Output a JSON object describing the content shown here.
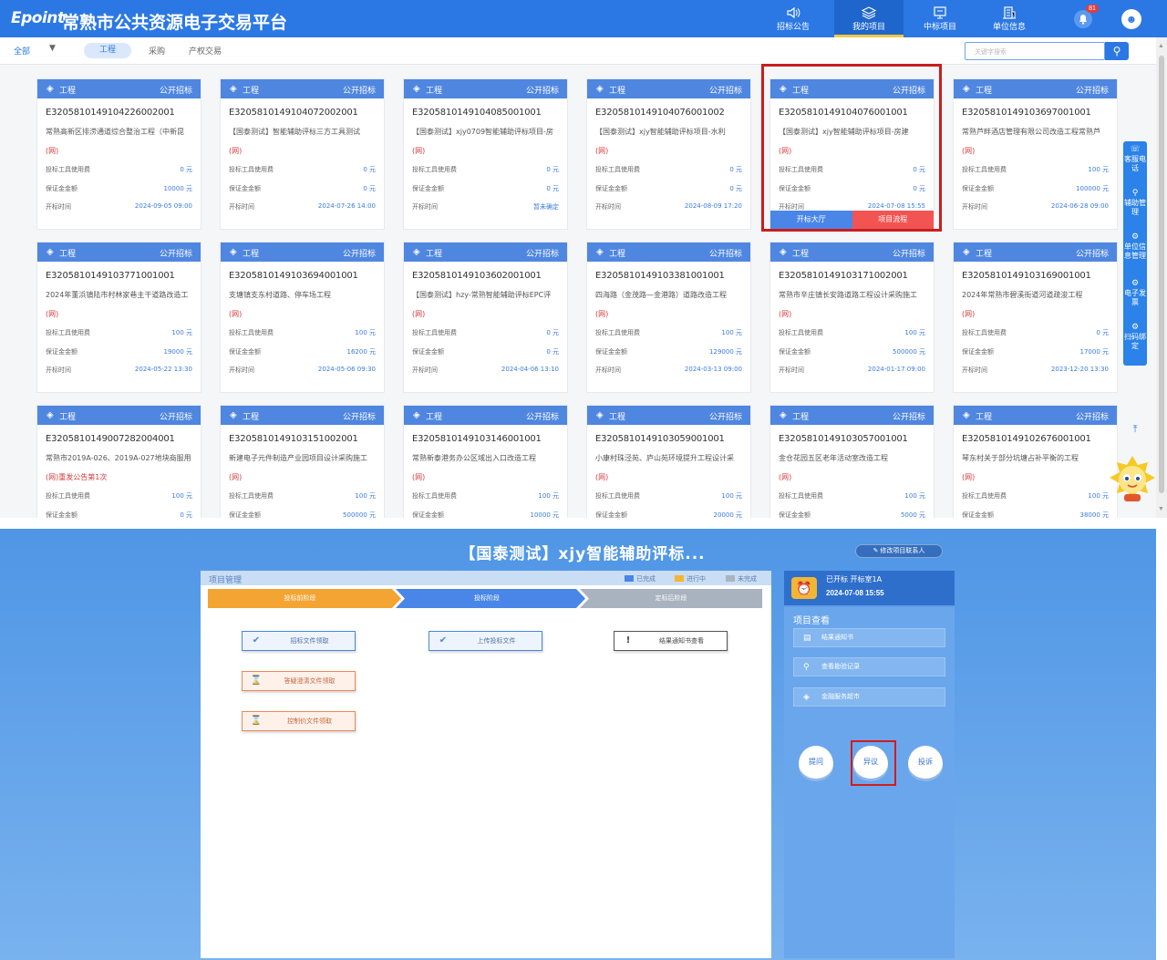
{
  "header": {
    "logo": "Epoint",
    "title": "常熟市公共资源电子交易平台",
    "nav": [
      {
        "label": "招标公告",
        "icon": "speaker-icon",
        "active": false
      },
      {
        "label": "我的项目",
        "icon": "layers-icon",
        "active": true
      },
      {
        "label": "中标项目",
        "icon": "monitor-icon",
        "active": false
      },
      {
        "label": "单位信息",
        "icon": "building-icon",
        "active": false
      }
    ],
    "notification_count": "81"
  },
  "filter": {
    "scope": "全部",
    "tabs": [
      "工程",
      "采购",
      "产权交易"
    ],
    "search_placeholder": "关键字搜索"
  },
  "card_labels": {
    "category": "工程",
    "type": "公开招标",
    "tool_fee": "投标工具使用费",
    "deposit": "保证金金额",
    "open_time": "开标时间",
    "btn_hall": "开标大厅",
    "btn_flow": "项目流程"
  },
  "cards": [
    {
      "code": "E3205810149104226002001",
      "name": "常熟高新区排涝通道综合整治工程（中新昆",
      "net": "(网)",
      "fee": "0 元",
      "deposit": "10000 元",
      "time": "2024-09-05 09:00"
    },
    {
      "code": "E3205810149104072002001",
      "name": "【国泰测试】智能辅助评标三方工具测试",
      "net": "(网)",
      "fee": "0 元",
      "deposit": "0 元",
      "time": "2024-07-26 14:00"
    },
    {
      "code": "E3205810149104085001001",
      "name": "【国泰测试】xjy0709智能辅助评标项目-房",
      "net": "(网)",
      "fee": "0 元",
      "deposit": "0 元",
      "time": "暂未确定"
    },
    {
      "code": "E3205810149104076001002",
      "name": "【国泰测试】xjy智能辅助评标项目-水利",
      "net": "(网)",
      "fee": "0 元",
      "deposit": "0 元",
      "time": "2024-08-09 17:20"
    },
    {
      "code": "E3205810149104076001001",
      "name": "【国泰测试】xjy智能辅助评标项目-房建",
      "net": "(网)",
      "fee": "0 元",
      "deposit": "0 元",
      "time": "2024-07-08 15:55"
    },
    {
      "code": "E3205810149103697001001",
      "name": "常熟芦畔酒店管理有限公司改造工程常熟芦",
      "net": "(网)",
      "fee": "100 元",
      "deposit": "100000 元",
      "time": "2024-06-28 09:00"
    },
    {
      "code": "E3205810149103771001001",
      "name": "2024年董浜镇陆市村林家巷主干道路改造工",
      "net": "(网)",
      "fee": "100 元",
      "deposit": "19000 元",
      "time": "2024-05-22 13:30"
    },
    {
      "code": "E3205810149103694001001",
      "name": "支塘镇支东村道路、停车场工程",
      "net": "(网)",
      "fee": "100 元",
      "deposit": "16200 元",
      "time": "2024-05-06 09:30"
    },
    {
      "code": "E3205810149103602001001",
      "name": "【国泰测试】hzy-常熟智能辅助评标EPC评",
      "net": "(网)",
      "fee": "0 元",
      "deposit": "0 元",
      "time": "2024-04-06 13:10"
    },
    {
      "code": "E3205810149103381001001",
      "name": "四海路（金茂路—金港路）道路改造工程",
      "net": "(网)",
      "fee": "100 元",
      "deposit": "129000 元",
      "time": "2024-03-13 09:00"
    },
    {
      "code": "E3205810149103171002001",
      "name": "常熟市辛庄镇长安路道路工程设计采购施工",
      "net": "(网)",
      "fee": "100 元",
      "deposit": "500000 元",
      "time": "2024-01-17 09:00"
    },
    {
      "code": "E3205810149103169001001",
      "name": "2024年常熟市碧溪街道河道疏浚工程",
      "net": "(网)",
      "fee": "0 元",
      "deposit": "17000 元",
      "time": "2023-12-20 13:30"
    },
    {
      "code": "E3205810149007282004001",
      "name": "常熟市2019A-026、2019A-027地块商服用",
      "net": "(网)重发公告第1次",
      "fee": "100 元",
      "deposit": "0 元",
      "time": ""
    },
    {
      "code": "E3205810149103151002001",
      "name": "新建电子元件制造产业园项目设计采购施工",
      "net": "(网)",
      "fee": "100 元",
      "deposit": "500000 元",
      "time": ""
    },
    {
      "code": "E3205810149103146001001",
      "name": "常熟新泰港务办公区域出入口改造工程",
      "net": "(网)",
      "fee": "100 元",
      "deposit": "10000 元",
      "time": ""
    },
    {
      "code": "E3205810149103059001001",
      "name": "小康村珠泾苑、庐山苑环境提升工程设计采",
      "net": "(网)",
      "fee": "100 元",
      "deposit": "20000 元",
      "time": ""
    },
    {
      "code": "E3205810149103057001001",
      "name": "金仓花园五区老年活动室改造工程",
      "net": "(网)",
      "fee": "100 元",
      "deposit": "5000 元",
      "time": ""
    },
    {
      "code": "E3205810149102676001001",
      "name": "琴东村关于部分坑塘占补平衡的工程",
      "net": "(网)",
      "fee": "100 元",
      "deposit": "38000 元",
      "time": ""
    }
  ],
  "sidebar": [
    {
      "label": "客服电话",
      "icon": "headset-icon"
    },
    {
      "label": "辅助管理",
      "icon": "search-icon"
    },
    {
      "label": "单位信息管理",
      "icon": "gear-icon"
    },
    {
      "label": "电子发票",
      "icon": "gear-icon"
    },
    {
      "label": "扫码绑定",
      "icon": "gear-icon"
    }
  ],
  "project": {
    "title": "【国泰测试】xjy智能辅助评标...",
    "edit_contact": "修改项目联系人",
    "panel_title": "项目管理",
    "legend": [
      {
        "label": "已完成",
        "color": "#4a86e8"
      },
      {
        "label": "进行中",
        "color": "#f3b632"
      },
      {
        "label": "未完成",
        "color": "#a9b4c2"
      }
    ],
    "steps": [
      {
        "label": "投标前阶段",
        "color": "#f4a433"
      },
      {
        "label": "投标阶段",
        "color": "#4a86e8"
      },
      {
        "label": "定标后阶段",
        "color": "#a9b2bf"
      }
    ],
    "tasks": [
      {
        "label": "招标文件领取",
        "icon": "check-icon",
        "style": "blue"
      },
      {
        "label": "上传投标文件",
        "icon": "check-icon",
        "style": "blue"
      },
      {
        "label": "结果通知书查看",
        "icon": "exclamation-icon",
        "style": "dark"
      },
      {
        "label": "答疑澄清文件领取",
        "icon": "hourglass-icon",
        "style": "orange"
      },
      {
        "label": "控制价文件领取",
        "icon": "hourglass-icon",
        "style": "orange"
      }
    ],
    "status_line1": "已开标 开标室1A",
    "status_line2": "2024-07-08 15:55",
    "view_section": "项目查看",
    "view_buttons": [
      {
        "label": "结果通知书",
        "icon": "document-icon"
      },
      {
        "label": "查看勘验记录",
        "icon": "inspect-icon"
      },
      {
        "label": "金融服务超市",
        "icon": "shield-icon"
      }
    ],
    "actions": [
      "提问",
      "异议",
      "投诉"
    ]
  }
}
